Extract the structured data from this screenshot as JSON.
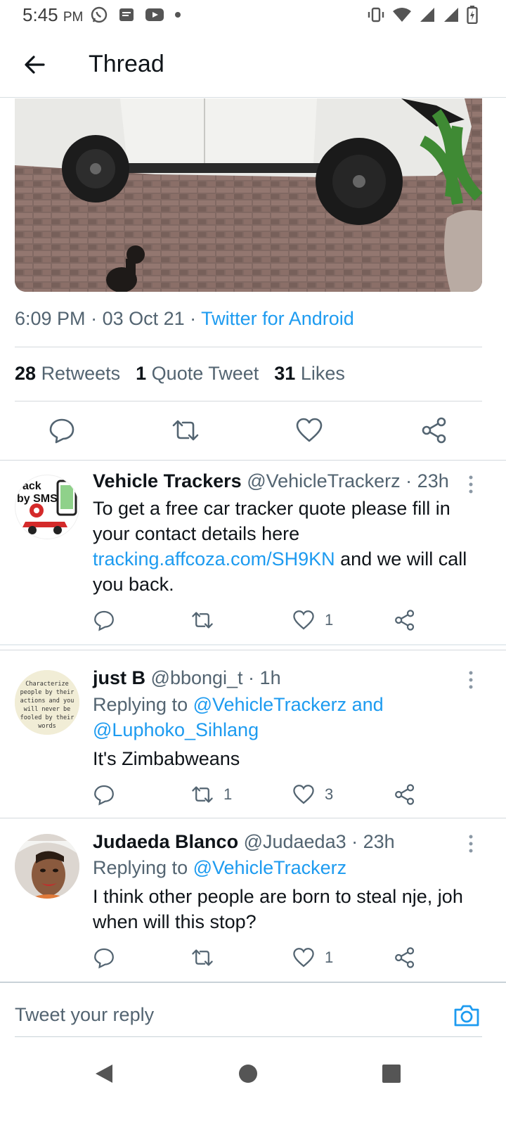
{
  "status_bar": {
    "time": "5:45",
    "ampm": "PM"
  },
  "header": {
    "title": "Thread"
  },
  "tweet": {
    "time": "6:09 PM",
    "date": "03 Oct 21",
    "client": "Twitter for Android",
    "retweets_count": "28",
    "retweets_label": "Retweets",
    "quotes_count": "1",
    "quotes_label": "Quote Tweet",
    "likes_count": "31",
    "likes_label": "Likes"
  },
  "replies": [
    {
      "name": "Vehicle Trackers",
      "handle": "@VehicleTrackerz",
      "age": "23h",
      "avatar_text_1": "ack",
      "avatar_text_2": "by SMS",
      "text_1": "To get a free car tracker quote please fill in your contact details here ",
      "link": "tracking.affcoza.com/SH9KN",
      "text_2": " and we will call you back.",
      "retweets": "",
      "likes": "1"
    },
    {
      "name": "just B",
      "handle": "@bbongi_t",
      "age": "1h",
      "avatar_text": "Characterize people by their actions and you will never be fooled by their words",
      "replying_label": "Replying to",
      "replying_to": "@VehicleTrackerz and @Luphoko_Sihlang",
      "text": "It's Zimbabweans",
      "retweets": "1",
      "likes": "3"
    },
    {
      "name": "Judaeda Blanco",
      "handle": "@Judaeda3",
      "age": "23h",
      "replying_label": "Replying to",
      "replying_to": "@VehicleTrackerz",
      "text": "I think other people  are born to steal nje, joh when will this stop?",
      "retweets": "",
      "likes": "1"
    }
  ],
  "compose": {
    "placeholder": "Tweet your reply"
  },
  "colors": {
    "accent": "#1d9bf0",
    "secondary_text": "#536471",
    "divider": "#d4d9dd"
  }
}
